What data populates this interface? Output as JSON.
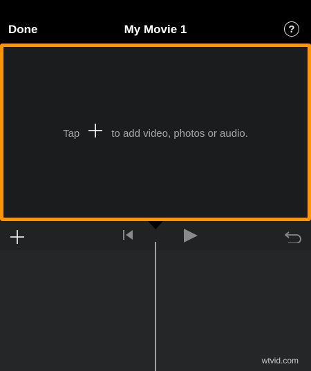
{
  "header": {
    "done_label": "Done",
    "title": "My Movie 1",
    "help_label": "?"
  },
  "viewer": {
    "hint_before": "Tap",
    "hint_after": "to add video, photos or audio.",
    "border_color": "#ff9500"
  },
  "controls": {
    "add_icon": "plus-icon",
    "skip_back_icon": "skip-to-start-icon",
    "play_icon": "play-icon",
    "undo_icon": "undo-icon"
  },
  "watermark": "wtvid.com"
}
